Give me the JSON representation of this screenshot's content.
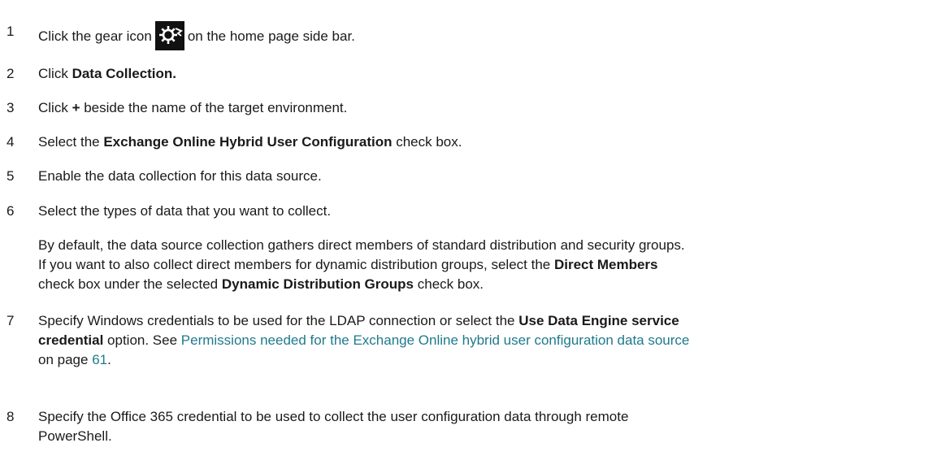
{
  "steps": [
    {
      "num": "1",
      "pre": "Click the gear icon",
      "post": "on the home page side bar."
    },
    {
      "num": "2",
      "pre": "Click ",
      "bold": "Data Collection."
    },
    {
      "num": "3",
      "pre": "Click ",
      "bold": "+",
      "post": " beside the name of the target environment."
    },
    {
      "num": "4",
      "pre": "Select the ",
      "bold": "Exchange Online Hybrid User Configuration",
      "post": " check box."
    },
    {
      "num": "5",
      "text": "Enable the data collection for this data source."
    },
    {
      "num": "6",
      "text": "Select the types of data that you want to collect."
    },
    {
      "num": "7",
      "line1_pre": "Specify Windows credentials to be used for the LDAP connection or select the ",
      "line1_bold": "Use Data Engine service",
      "line2_bold": "credential",
      "line2_mid": " option. See ",
      "line2_link": "Permissions needed for the Exchange Online hybrid user configuration data source",
      "line3_pre": "on page ",
      "line3_link": "61",
      "line3_post": "."
    },
    {
      "num": "8",
      "line1": "Specify the Office 365 credential to be used to collect the user configuration data through remote",
      "line2": "PowerShell."
    }
  ],
  "note": {
    "line1": "By default, the data source collection gathers direct members of standard distribution and security groups.",
    "line2_pre": "If you want to also collect direct members for dynamic distribution groups, select the ",
    "line2_bold": "Direct Members",
    "line3_pre": "check box under the selected ",
    "line3_bold": "Dynamic Distribution Groups",
    "line3_post": " check box."
  },
  "icons": {
    "gear": "gear-icon"
  }
}
